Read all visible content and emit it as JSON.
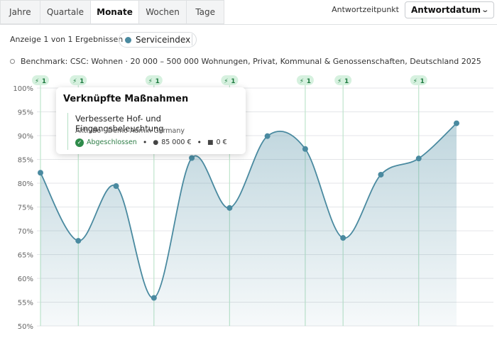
{
  "tabs": [
    {
      "label": "Jahre",
      "active": false
    },
    {
      "label": "Quartale",
      "active": false
    },
    {
      "label": "Monate",
      "active": true
    },
    {
      "label": "Wochen",
      "active": false
    },
    {
      "label": "Tage",
      "active": false
    }
  ],
  "response_time": {
    "label": "Antwortzeitpunkt",
    "selected": "Antwortdatum"
  },
  "results_text": "Anzeige 1 von 1 Ergebnissen",
  "legend": {
    "series_name": "Serviceindex",
    "color": "#4a8aa0"
  },
  "benchmark_text": "Benchmark: CSC: Wohnen · 20 000 – 500 000 Wohnungen, Privat, Kommunal & Genossenschaften, Deutschland 2025",
  "tooltip": {
    "title": "Verknüpfte Maßnahmen",
    "measure": "Verbesserte Hof- und Eingangsbeleuchtung",
    "organization": "AktivBo - Demo Admin Germany",
    "status": "Abgeschlossen",
    "cost": "85 000 €",
    "budget": "0 €"
  },
  "chart_data": {
    "type": "area",
    "y_ticks": [
      "100%",
      "95%",
      "90%",
      "85%",
      "80%",
      "75%",
      "70%",
      "65%",
      "60%",
      "55%",
      "50%"
    ],
    "ylim": [
      50,
      100
    ],
    "grid": true,
    "series": [
      {
        "name": "Serviceindex",
        "color": "#4a8aa0",
        "values": [
          82.2,
          67.9,
          79.4,
          55.9,
          85.3,
          74.8,
          89.9,
          87.2,
          68.5,
          81.8,
          85.2,
          92.6
        ]
      }
    ],
    "measure_markers": [
      {
        "index": 0,
        "label": "1"
      },
      {
        "index": 1,
        "label": "1"
      },
      {
        "index": 3,
        "label": "1"
      },
      {
        "index": 5,
        "label": "1"
      },
      {
        "index": 7,
        "label": "1"
      },
      {
        "index": 8,
        "label": "1"
      },
      {
        "index": 10,
        "label": "1"
      }
    ]
  }
}
